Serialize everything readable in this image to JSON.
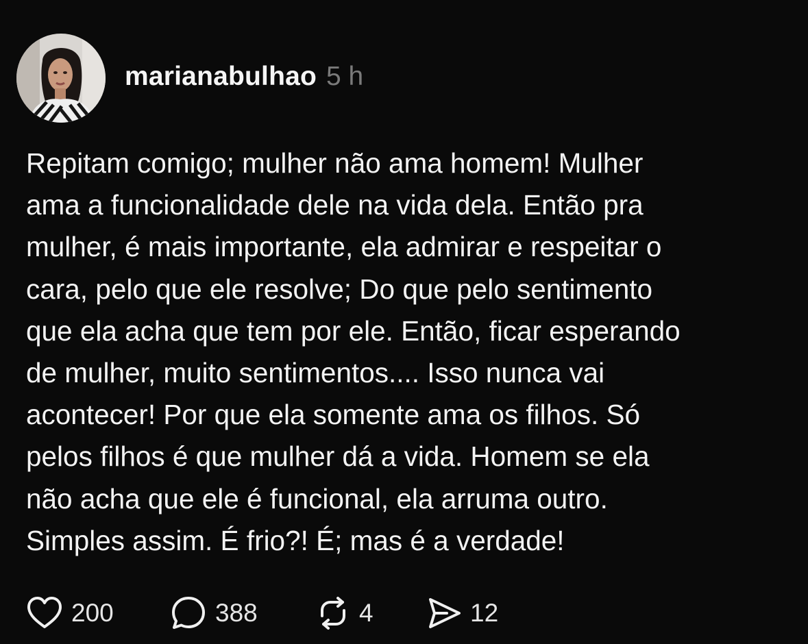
{
  "post": {
    "username": "marianabulhao",
    "time": "5 h",
    "text": "Repitam comigo; mulher não ama homem! Mulher\nama a funcionalidade dele na vida dela. Então pra\nmulher, é mais importante, ela admirar e respeitar o\ncara, pelo que ele resolve; Do que pelo sentimento\nque ela acha que tem por ele. Então, ficar esperando\nde mulher, muito sentimentos.... Isso nunca vai\nacontecer! Por que ela somente ama os filhos. Só\npelos filhos é que mulher dá a vida. Homem se ela\nnão acha que ele é funcional, ela arruma outro.\nSimples assim. É frio?! É; mas é a verdade!",
    "actions": {
      "likes": "200",
      "comments": "388",
      "reposts": "4",
      "shares": "12"
    }
  },
  "icons": {
    "like": "heart-icon",
    "comment": "speech-bubble-icon",
    "repost": "repost-arrows-icon",
    "share": "paper-plane-icon"
  },
  "colors": {
    "background": "#0a0a0a",
    "text": "#f3f3f3",
    "muted": "#7a7a7a"
  }
}
